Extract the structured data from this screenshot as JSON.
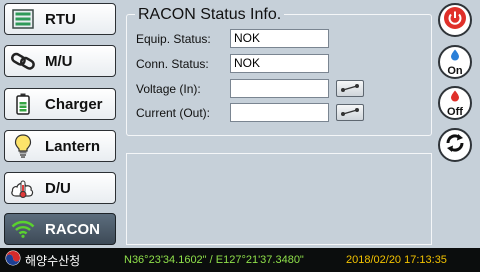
{
  "sidebar": {
    "items": [
      {
        "label": "RTU"
      },
      {
        "label": "M/U"
      },
      {
        "label": "Charger"
      },
      {
        "label": "Lantern"
      },
      {
        "label": "D/U"
      },
      {
        "label": "RACON",
        "active": true
      }
    ]
  },
  "panel": {
    "title": "RACON Status Info.",
    "fields": [
      {
        "label": "Equip. Status:",
        "value": "NOK"
      },
      {
        "label": "Conn. Status:",
        "value": "NOK"
      },
      {
        "label": "Voltage (In):",
        "value": ""
      },
      {
        "label": "Current (Out):",
        "value": ""
      }
    ]
  },
  "right_buttons": {
    "on_label": "On",
    "off_label": "Off"
  },
  "status_bar": {
    "org_name": "해양수산청",
    "coordinates": "N36°23'34.1602\" / E127°21'37.3480\"",
    "datetime": "2018/02/20 17:13:35"
  },
  "colors": {
    "background": "#c6d0d9",
    "active_tab": "#4a5866",
    "power_red": "#e0302a",
    "coords_green": "#8fe04a",
    "clock_yellow": "#f2c200"
  }
}
